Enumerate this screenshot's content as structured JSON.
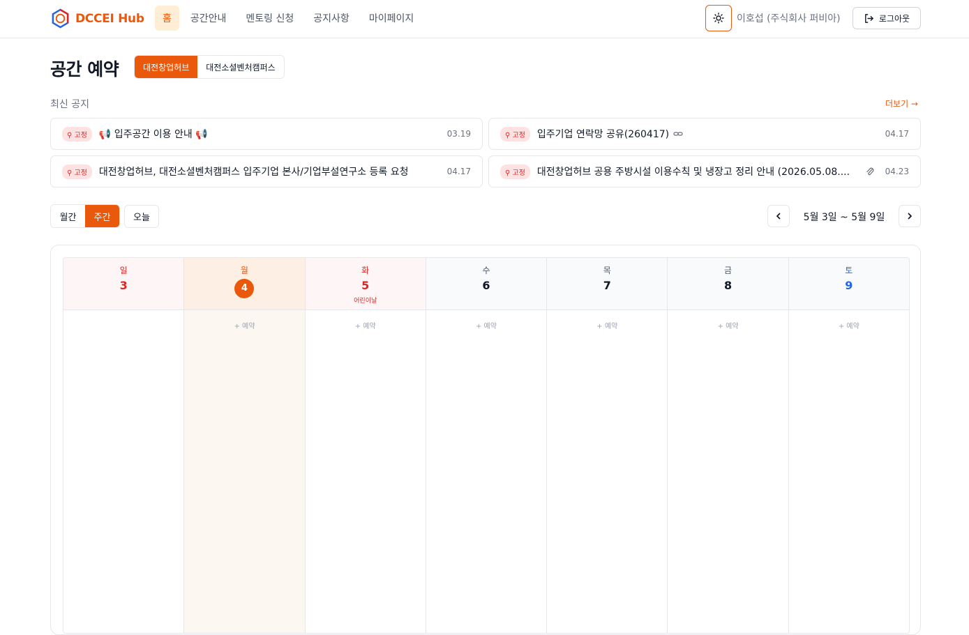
{
  "header": {
    "logo_text": "DCCEI Hub",
    "nav": [
      {
        "label": "홈",
        "active": true
      },
      {
        "label": "공간안내"
      },
      {
        "label": "멘토링 신청"
      },
      {
        "label": "공지사항"
      },
      {
        "label": "마이페이지"
      }
    ],
    "theme_icon": "sun-icon",
    "user_name": "이호섭 (주식회사 퍼비아)",
    "logout_label": "로그아웃",
    "logout_icon": "logout-icon"
  },
  "page": {
    "title": "공간 예약",
    "space_tabs": [
      {
        "label": "대전창업허브",
        "active": true
      },
      {
        "label": "대전소셜벤처캠퍼스"
      }
    ]
  },
  "notices": {
    "heading": "최신 공지",
    "more_label": "더보기 →",
    "pin_label": "고정",
    "items": [
      {
        "title": "📢 입주공간 이용 안내 📢",
        "date": "03.19",
        "icon": ""
      },
      {
        "title": "입주기업 연락망 공유(260417)",
        "date": "04.17",
        "icon": "link-icon"
      },
      {
        "title": "대전창업허브, 대전소셜벤처캠퍼스 입주기업 본사/기업부설연구소 등록 요청",
        "date": "04.17",
        "icon": ""
      },
      {
        "title": "대전창업허브 공용 주방시설 이용수칙 및 냉장고 정리 안내 (2026.05.08....",
        "date": "04.23",
        "icon": "paperclip-icon"
      }
    ]
  },
  "calendar": {
    "view_month": "월간",
    "view_week": "주간",
    "active_view": "week",
    "today_label": "오늘",
    "range": "5월 3일 ~ 5월 9일",
    "reserve_label": "+ 예약",
    "days": [
      {
        "name": "일",
        "num": "3",
        "color": "red",
        "holiday": "",
        "today": false,
        "reservable": false
      },
      {
        "name": "월",
        "num": "4",
        "color": "",
        "holiday": "",
        "today": true,
        "reservable": true
      },
      {
        "name": "화",
        "num": "5",
        "color": "red",
        "holiday": "어린이날",
        "today": false,
        "reservable": true
      },
      {
        "name": "수",
        "num": "6",
        "color": "",
        "holiday": "",
        "today": false,
        "reservable": true
      },
      {
        "name": "목",
        "num": "7",
        "color": "",
        "holiday": "",
        "today": false,
        "reservable": true
      },
      {
        "name": "금",
        "num": "8",
        "color": "",
        "holiday": "",
        "today": false,
        "reservable": true
      },
      {
        "name": "토",
        "num": "9",
        "color": "blue",
        "holiday": "",
        "today": false,
        "reservable": true
      }
    ]
  },
  "colors": {
    "accent": "#ea580c",
    "holiday": "#dc2626",
    "saturday": "#2563eb"
  }
}
